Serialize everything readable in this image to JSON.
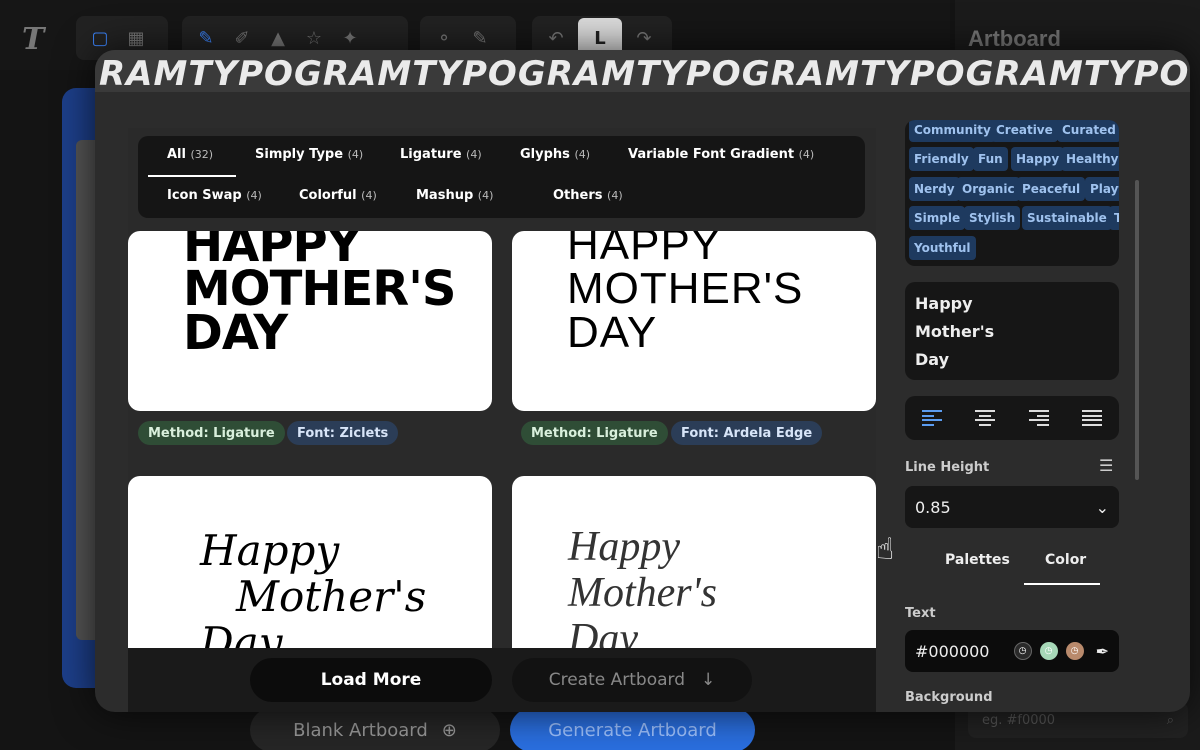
{
  "background": {
    "logo": "T",
    "toolbar_icons": [
      "square-icon",
      "grid-icon",
      "pen-icon",
      "text-path-icon",
      "vertex-icon",
      "star-path-icon",
      "sparkle-path-icon",
      "node-a-icon",
      "node-b-icon"
    ],
    "toolbar_L": "L",
    "right_title": "Artboard",
    "blank_artboard": "Blank Artboard",
    "generate_artboard": "Generate Artboard",
    "search_placeholder": "eg. #f0000"
  },
  "marquee": "RAMTYPOGRAMTYPOGRAMTYPOGRAMTYPOGRAMTYPOGRAM",
  "filters": [
    {
      "label": "All",
      "count": "(32)"
    },
    {
      "label": "Simply Type",
      "count": "(4)"
    },
    {
      "label": "Ligature",
      "count": "(4)"
    },
    {
      "label": "Glyphs",
      "count": "(4)"
    },
    {
      "label": "Variable Font Gradient",
      "count": "(4)"
    },
    {
      "label": "Icon Swap",
      "count": "(4)"
    },
    {
      "label": "Colorful",
      "count": "(4)"
    },
    {
      "label": "Mashup",
      "count": "(4)"
    },
    {
      "label": "Others",
      "count": "(4)"
    }
  ],
  "cards": [
    {
      "line1": "HAPPY",
      "line2": "MOTHER'S",
      "line3": "DAY",
      "method": "Method: Ligature",
      "font": "Font: Ziclets"
    },
    {
      "line1": "HAPPY",
      "line2": "MOTHER'S",
      "line3": "DAY",
      "method": "Method: Ligature",
      "font": "Font: Ardela Edge"
    },
    {
      "line1": "Happy",
      "line2": "Mother's",
      "line3": "Day"
    },
    {
      "line1": "Happy",
      "line2": "Mother's",
      "line3": "Day"
    }
  ],
  "buttons": {
    "load_more": "Load More",
    "create_artboard": "Create Artboard"
  },
  "tags": [
    "Community",
    "Creative",
    "Curated",
    "Friendly",
    "Fun",
    "Happy",
    "Healthy",
    "Nerdy",
    "Organic",
    "Peaceful",
    "Playf",
    "Simple",
    "Stylish",
    "Sustainable",
    "T",
    "Youthful"
  ],
  "text_content": {
    "line1": "Happy",
    "line2": "Mother's",
    "line3": "Day"
  },
  "line_height": {
    "label": "Line Height",
    "value": "0.85"
  },
  "tabs": {
    "palettes": "Palettes",
    "color": "Color"
  },
  "text_color": {
    "label": "Text",
    "value": "#000000"
  },
  "swatch_colors": [
    "#2a2a2a",
    "#a7d8b8",
    "#b98a6c"
  ],
  "background_label": "Background"
}
